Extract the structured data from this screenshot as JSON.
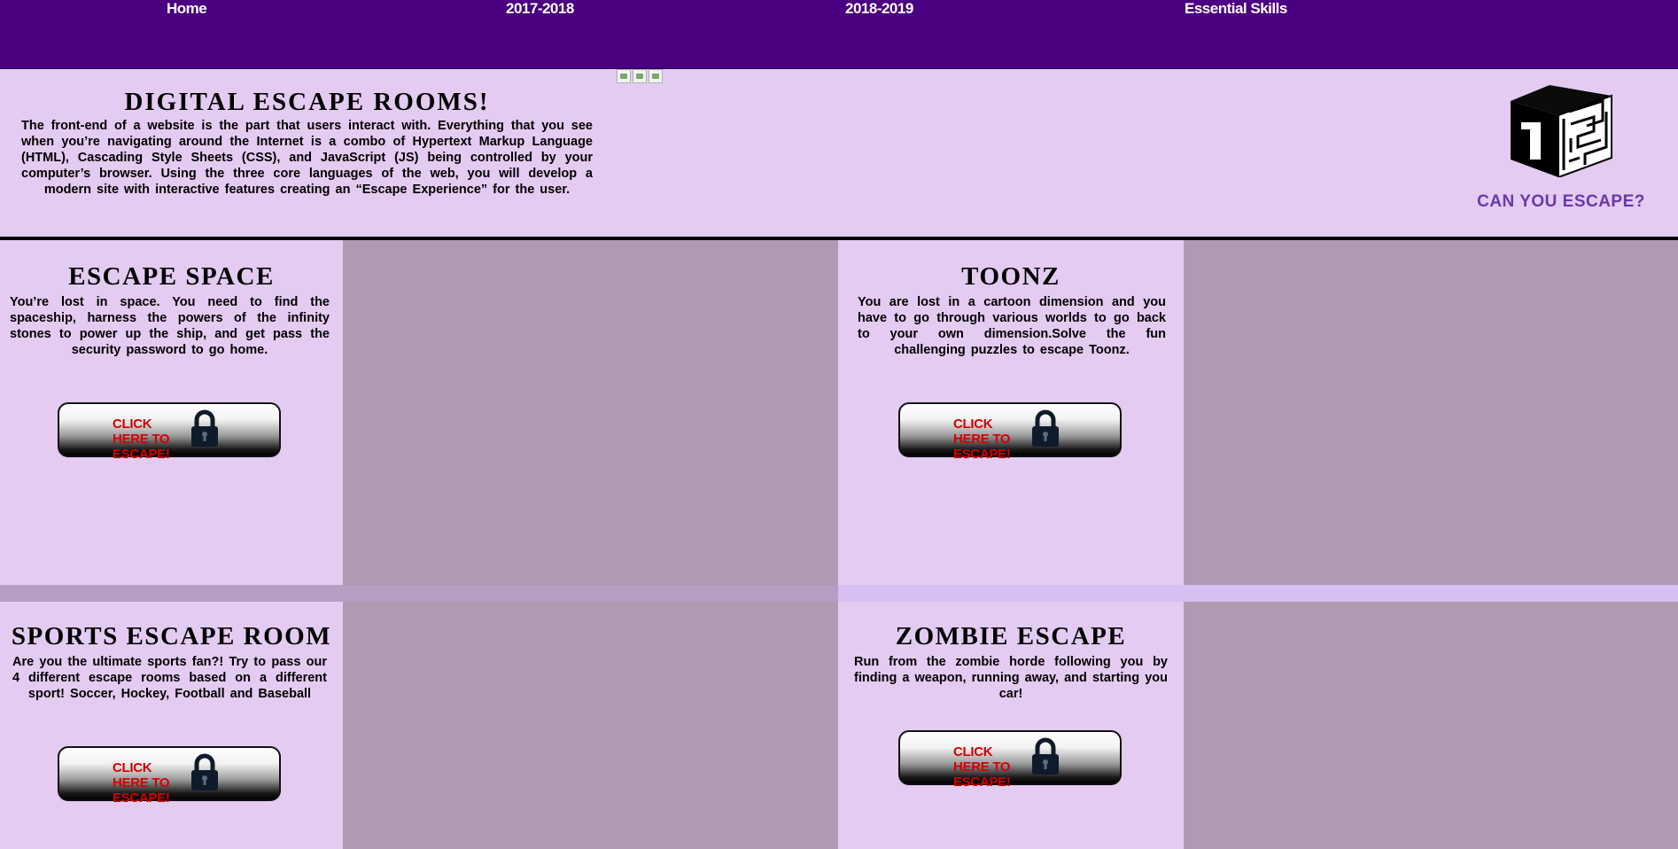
{
  "nav": {
    "items": [
      {
        "label": "Home"
      },
      {
        "label": "2017-2018"
      },
      {
        "label": "2018-2019"
      },
      {
        "label": "Essential Skills"
      }
    ]
  },
  "header": {
    "title": "DIGITAL ESCAPE ROOMS!",
    "description": "The front-end of a website is the part that users interact with. Everything that you see when you’re navigating around the Internet is a combo of Hypertext Markup Language (HTML), Cascading Style Sheets (CSS), and JavaScript (JS) being controlled by your computer’s browser. Using the three core languages of the web, you will develop a modern site with interactive features creating an “Escape Experience” for the user.",
    "logo_text": "CAN YOU ESCAPE?"
  },
  "rooms": [
    {
      "title": "ESCAPE SPACE",
      "description": "You’re lost in space. You need to find the spaceship, harness the powers of the infinity stones to power up the ship, and get pass the security password to go home.",
      "button": "CLICK HERE TO ESCAPE!"
    },
    {
      "title": "TOONZ",
      "description": "You are lost in a cartoon dimension and you have to go through various worlds to go back to your own dimension.Solve the fun challenging puzzles to escape Toonz.",
      "button": "CLICK HERE TO ESCAPE!"
    },
    {
      "title": "SPORTS ESCAPE ROOM",
      "description": "Are you the ultimate sports fan?! Try to pass our 4 different escape rooms based on a different sport! Soccer, Hockey, Football and Baseball",
      "button": "CLICK HERE TO ESCAPE!"
    },
    {
      "title": "ZOMBIE ESCAPE",
      "description": "Run from the zombie horde following you by finding a weapon, running away, and starting you car!",
      "button": "CLICK HERE TO ESCAPE!"
    }
  ],
  "colors": {
    "nav_bg": "#4a0080",
    "page_bg": "#e3cbf1",
    "filler_bg": "#af9ab1",
    "logo_text": "#6b37a8",
    "button_text": "#d40000"
  },
  "icons": [
    "broken-image-icon",
    "maze-cube-logo",
    "padlock-icon"
  ]
}
